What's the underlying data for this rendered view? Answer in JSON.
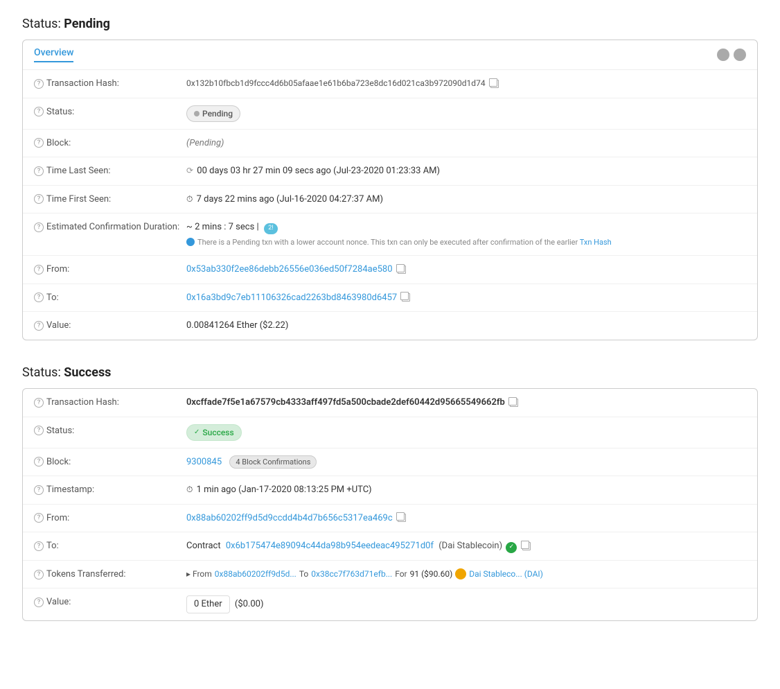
{
  "pending_section": {
    "title": "Status:",
    "title_bold": "Pending",
    "card": {
      "tab": "Overview",
      "rows": {
        "tx_hash_label": "Transaction Hash:",
        "tx_hash_value": "0x132b10fbcb1d9fccc4d6b05afaae1e61b6ba723e8dc16d021ca3b972090d1d74",
        "status_label": "Status:",
        "status_value": "Pending",
        "block_label": "Block:",
        "block_value": "(Pending)",
        "time_last_seen_label": "Time Last Seen:",
        "time_last_seen_value": "00 days 03 hr 27 min 09 secs ago (Jul-23-2020 01:23:33 AM)",
        "time_first_seen_label": "Time First Seen:",
        "time_first_seen_value": "7 days 22 mins ago (Jul-16-2020 04:27:37 AM)",
        "est_conf_label": "Estimated Confirmation Duration:",
        "est_conf_value": "~ 2 mins : 7 secs |",
        "est_conf_note": "There is a Pending txn with a lower account nonce. This txn can only be executed after confirmation of the earlier Txn Hash",
        "from_label": "From:",
        "from_value": "0x53ab330f2ee86debb26556e036ed50f7284ae580",
        "to_label": "To:",
        "to_value": "0x16a3bd9c7eb11106326cad2263bd8463980d6457",
        "value_label": "Value:",
        "value_amount": "0.00841264 Ether ($2.22)"
      }
    }
  },
  "success_section": {
    "title": "Status:",
    "title_bold": "Success",
    "card": {
      "rows": {
        "tx_hash_label": "Transaction Hash:",
        "tx_hash_value": "0xcffade7f5e1a67579cb4333aff497fd5a500cbade2def60442d95665549662fb",
        "status_label": "Status:",
        "status_value": "Success",
        "block_label": "Block:",
        "block_number": "9300845",
        "block_confirmations": "4 Block Confirmations",
        "timestamp_label": "Timestamp:",
        "timestamp_value": "1 min ago (Jan-17-2020 08:13:25 PM +UTC)",
        "from_label": "From:",
        "from_value": "0x88ab60202ff9d5d9ccdd4b4d7b656c5317ea469c",
        "to_label": "To:",
        "to_prefix": "Contract",
        "to_contract": "0x6b175474e89094c44da98b954eedeac495271d0f",
        "to_name": "(Dai Stablecoin)",
        "tokens_label": "Tokens Transferred:",
        "tokens_from_prefix": "▸ From",
        "tokens_from": "0x88ab60202ff9d5d...",
        "tokens_to_prefix": "To",
        "tokens_to": "0x38cc7f763d71efb...",
        "tokens_for_prefix": "For",
        "tokens_amount": "91 ($90.60)",
        "tokens_name": "Dai Stableco... (DAI)",
        "value_label": "Value:",
        "value_ether": "0 Ether",
        "value_usd": "($0.00)"
      }
    }
  },
  "icons": {
    "help": "?",
    "copy": "⧉",
    "check": "✓",
    "clock": "⏱",
    "spinner": "⟳",
    "info": "ℹ"
  }
}
